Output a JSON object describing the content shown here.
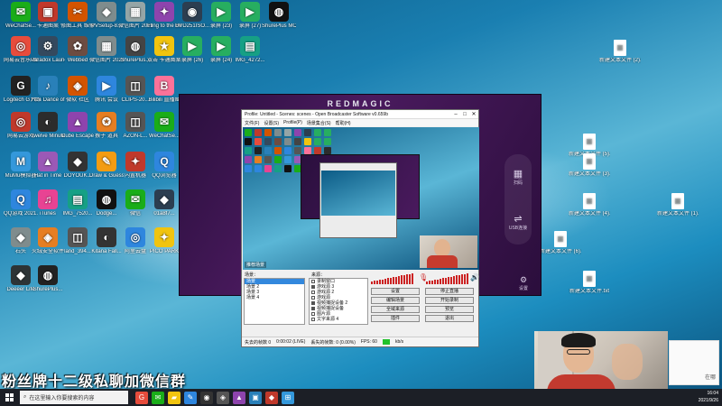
{
  "desktop_icons": [
    {
      "label": "WeChatSe...",
      "color": "#1aad19",
      "glyph": "✉"
    },
    {
      "label": "卡通图案",
      "color": "#c0392b",
      "glyph": "▣"
    },
    {
      "label": "修图工具 维修",
      "color": "#d35400",
      "glyph": "✂"
    },
    {
      "label": "PVSetup-8...",
      "color": "#7f8c8d",
      "glyph": "◆"
    },
    {
      "label": "微信图片 20210822...",
      "color": "#95a5a6",
      "glyph": "▦"
    },
    {
      "label": "Fling to the Finish 破解...",
      "color": "#8e44ad",
      "glyph": "✦"
    },
    {
      "label": "DVD251ISO...",
      "color": "#2c3e50",
      "glyph": "◉"
    },
    {
      "label": "录屏 (23)",
      "color": "#27ae60",
      "glyph": "▶"
    },
    {
      "label": "录屏 (27)",
      "color": "#27ae60",
      "glyph": "▶"
    },
    {
      "label": "ShurePlus MOTIV",
      "color": "#111111",
      "glyph": "◍"
    },
    {
      "label": "网易云音乐 2021...",
      "color": "#e74c3c",
      "glyph": "◎"
    },
    {
      "label": "Paradox Launcher v2",
      "color": "#34495e",
      "glyph": "⚙"
    },
    {
      "label": "Webbed",
      "color": "#6d4c41",
      "glyph": "✿"
    },
    {
      "label": "微信图片 20210822...",
      "color": "#7f8c8d",
      "glyph": "▦"
    },
    {
      "label": "ShurePlus...",
      "color": "#444444",
      "glyph": "◍"
    },
    {
      "label": "双击 卡通图案标...",
      "color": "#f1c40f",
      "glyph": "★"
    },
    {
      "label": "录屏 (26)",
      "color": "#27ae60",
      "glyph": "▶"
    },
    {
      "label": "录屏 (24)",
      "color": "#27ae60",
      "glyph": "▶"
    },
    {
      "label": "IMG_4272...",
      "color": "#16a085",
      "glyph": "▤"
    },
    {
      "label": "Logitech G HUB",
      "color": "#222222",
      "glyph": "G"
    },
    {
      "label": "六维 Dance of F...",
      "color": "#2980b9",
      "glyph": "♪"
    },
    {
      "label": "微软 社区",
      "color": "#d35400",
      "glyph": "◈"
    },
    {
      "label": "腾讯 会议",
      "color": "#2e86de",
      "glyph": "▶"
    },
    {
      "label": "CLIPS-20...",
      "color": "#555555",
      "glyph": "◫"
    },
    {
      "label": "Bilibili 直播姬",
      "color": "#fb7299",
      "glyph": "B"
    },
    {
      "label": "网易云游戏",
      "color": "#c0392b",
      "glyph": "◎"
    },
    {
      "label": "Twelve Minutes",
      "color": "#2c2c2c",
      "glyph": "◐"
    },
    {
      "label": "Cube Escape",
      "color": "#8e44ad",
      "glyph": "▲"
    },
    {
      "label": "猴子 道具",
      "color": "#e67e22",
      "glyph": "✪"
    },
    {
      "label": "AZON-L...",
      "color": "#555555",
      "glyph": "◫"
    },
    {
      "label": "WeChatSe...",
      "color": "#1aad19",
      "glyph": "✉"
    },
    {
      "label": "MuMu模拟器",
      "color": "#3498db",
      "glyph": "M"
    },
    {
      "label": "Hat in Time",
      "color": "#9b59b6",
      "glyph": "▲"
    },
    {
      "label": "DOYOUK...",
      "color": "#333333",
      "glyph": "◆"
    },
    {
      "label": "Draw & Guess",
      "color": "#f39c12",
      "glyph": "✎"
    },
    {
      "label": "内置机器",
      "color": "#c0392b",
      "glyph": "✦"
    },
    {
      "label": "QQ浏览器",
      "color": "#2e86de",
      "glyph": "Q"
    },
    {
      "label": "QQ游戏 2021...",
      "color": "#2e86de",
      "glyph": "Q"
    },
    {
      "label": "iTunes",
      "color": "#e84393",
      "glyph": "♫"
    },
    {
      "label": "IMG_7520...",
      "color": "#16a085",
      "glyph": "▤"
    },
    {
      "label": "Dodge...",
      "color": "#111111",
      "glyph": "◍"
    },
    {
      "label": "微信",
      "color": "#1aad19",
      "glyph": "✉"
    },
    {
      "label": "01a8f7...",
      "color": "#2c3e50",
      "glyph": "◆"
    },
    {
      "label": "石头",
      "color": "#7f8c8d",
      "glyph": "◆"
    },
    {
      "label": "火绒安全软件",
      "color": "#e67e22",
      "glyph": "◈"
    },
    {
      "label": "land_394...",
      "color": "#555555",
      "glyph": "◫"
    },
    {
      "label": "Kitana Fall...",
      "color": "#333333",
      "glyph": "◐"
    },
    {
      "label": "阿里云盘",
      "color": "#2e86de",
      "glyph": "◎"
    },
    {
      "label": "PICO PARK",
      "color": "#f1c40f",
      "glyph": "✦"
    },
    {
      "label": "Deeeer Life",
      "color": "#2d3436",
      "glyph": "◆"
    },
    {
      "label": "ShurePlus...",
      "color": "#222222",
      "glyph": "◍"
    }
  ],
  "right_icons": [
    {
      "label": "新建文本文件 (2).txt"
    },
    {
      "label": "新建文本文件 (5).txt"
    },
    {
      "label": "新建文本文件 (3).txt"
    },
    {
      "label": "新建文本文件 (4).txt"
    },
    {
      "label": "新建文本文件 (1).txt"
    },
    {
      "label": "新建文本文件 (6).txt"
    },
    {
      "label": "新建文本文件.txt"
    }
  ],
  "redmagic": {
    "title": "REDMAGIC",
    "side_buttons": [
      {
        "icon": "qr-icon",
        "glyph": "▦",
        "label": "扫码"
      },
      {
        "icon": "usb-icon",
        "glyph": "⇌",
        "label": "USB连接"
      }
    ],
    "settings_label": "设置"
  },
  "obs": {
    "title": "Profile: Untitled - Scenes: scenes - Open Broadcaster Software v0.659b",
    "menu": [
      "文件(F)",
      "设置(S)",
      "Profile(P)",
      "场景集合(S)",
      "帮助(H)"
    ],
    "preview_caption": "推荐场景",
    "scenes_label": "场景：",
    "sources_label": "来源：",
    "scenes": [
      "场景",
      "场景 2",
      "场景 3",
      "场景 4"
    ],
    "sources": [
      {
        "label": "录制窗口",
        "checked": false
      },
      {
        "label": "游戏源 3",
        "checked": true
      },
      {
        "label": "游戏源 2",
        "checked": false
      },
      {
        "label": "游戏源",
        "checked": false
      },
      {
        "label": "视频捕捉设备 2",
        "checked": true
      },
      {
        "label": "视频捕捉设备",
        "checked": true
      },
      {
        "label": "图片源",
        "checked": false
      },
      {
        "label": "文字来源 4",
        "checked": false
      }
    ],
    "buttons": {
      "settings": "设置",
      "stop_stream": "停止直播",
      "edit_scene": "编辑场景",
      "start_record": "开始录制",
      "global_sources": "全域来源",
      "preview": "预览",
      "plugins": "插件",
      "exit": "退出"
    },
    "status": {
      "dropped": "失去的帧数 0",
      "time": "0:00:02 (LIVE)",
      "dropped_frames": "丢失的帧数: 0 (0.00%)",
      "fps": "FPS: 60",
      "bitrate": "kb/s"
    }
  },
  "overlay_text": "粉丝牌十二级私聊加微信群",
  "webcam_card_label": "在哪",
  "taskbar": {
    "search_placeholder": "在这里输入你要搜索的内容",
    "apps": [
      {
        "icon": "chrome-icon",
        "color": "#e74c3c",
        "glyph": "G"
      },
      {
        "icon": "wechat-icon",
        "color": "#1aad19",
        "glyph": "✉"
      },
      {
        "icon": "folder-icon",
        "color": "#f1c40f",
        "glyph": "▰"
      },
      {
        "icon": "paint-icon",
        "color": "#2e86de",
        "glyph": "✎"
      },
      {
        "icon": "obs-icon",
        "color": "#333333",
        "glyph": "◉"
      },
      {
        "icon": "app-icon",
        "color": "#555555",
        "glyph": "◈"
      },
      {
        "icon": "game-icon",
        "color": "#8e44ad",
        "glyph": "▲"
      },
      {
        "icon": "monitor-icon",
        "color": "#2980b9",
        "glyph": "▣"
      },
      {
        "icon": "redmagic-icon",
        "color": "#c0392b",
        "glyph": "◆"
      },
      {
        "icon": "windows-icon",
        "color": "#3498db",
        "glyph": "⊞"
      }
    ],
    "clock_time": "16:04",
    "clock_date": "2021/9/26"
  }
}
